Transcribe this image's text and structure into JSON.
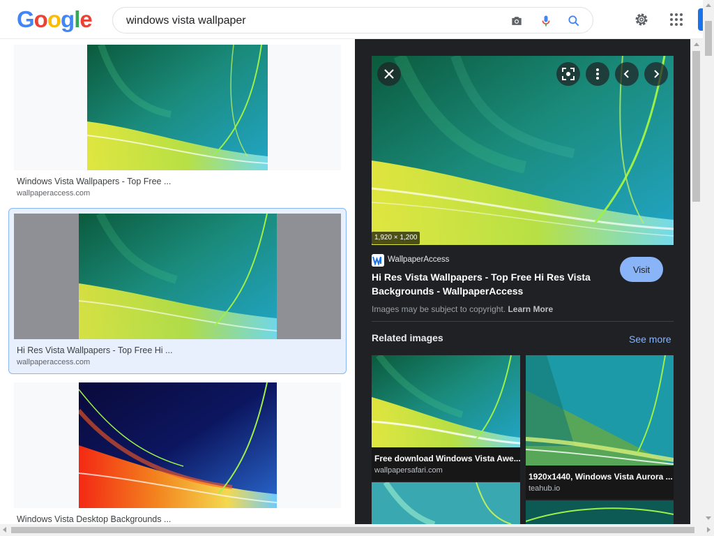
{
  "header": {
    "logo_letters": [
      "G",
      "o",
      "o",
      "g",
      "l",
      "e"
    ],
    "logo_colors": [
      "#4285f4",
      "#ea4335",
      "#fbbc05",
      "#4285f4",
      "#34a853",
      "#ea4335"
    ],
    "search_value": "windows vista wallpaper",
    "icons": [
      "camera-icon",
      "mic-icon",
      "search-icon",
      "settings-gear-icon",
      "apps-grid-icon"
    ]
  },
  "results": [
    {
      "title": "Windows Vista Wallpapers - Top Free ...",
      "site": "wallpaperaccess.com"
    },
    {
      "title": "Hi Res Vista Wallpapers - Top Free Hi ...",
      "site": "wallpaperaccess.com",
      "selected": true
    },
    {
      "title": "Windows Vista Desktop Backgrounds ...",
      "site": ""
    }
  ],
  "preview": {
    "dimensions": "1,920 × 1,200",
    "source_name": "WallpaperAccess",
    "source_logo_letter": "W",
    "title": "Hi Res Vista Wallpapers - Top Free Hi Res Vista Backgrounds - WallpaperAccess",
    "visit_label": "Visit",
    "copyright_text": "Images may be subject to copyright.",
    "learn_more": "Learn More",
    "related_heading": "Related images",
    "see_more": "See more",
    "related": [
      {
        "title": "Free download Windows Vista Awe...",
        "site": "wallpapersafari.com"
      },
      {
        "title": "1920x1440, Windows Vista Aurora ...",
        "site": "teahub.io"
      }
    ]
  },
  "colors": {
    "panel_bg": "#202124",
    "accent_blue": "#8ab4f8",
    "selected_card_bg": "#e8f0fe"
  }
}
